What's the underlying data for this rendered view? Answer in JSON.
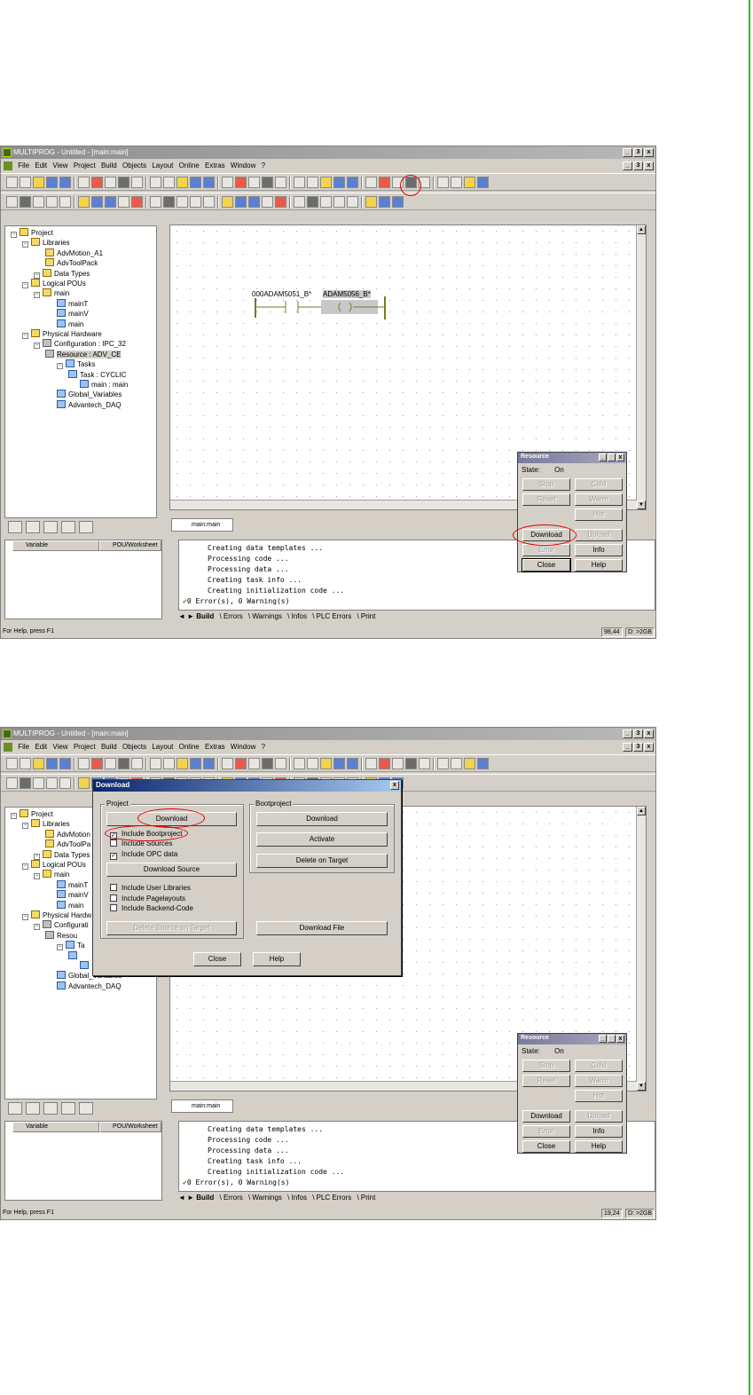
{
  "app": {
    "title_1": "MULTIPROG - Untitled - [main:main]",
    "title_2": "MULTIPROG - Untitled - [main:main]"
  },
  "menu": [
    "File",
    "Edit",
    "View",
    "Project",
    "Build",
    "Objects",
    "Layout",
    "Online",
    "Extras",
    "Window",
    "?"
  ],
  "window_buttons": {
    "minimize": "_",
    "restore": "3",
    "close": "x"
  },
  "tree": [
    {
      "label": "Project",
      "level": 0
    },
    {
      "label": "Libraries",
      "level": 1
    },
    {
      "label": "AdvMotion_A1",
      "level": 3
    },
    {
      "label": "AdvToolPack",
      "level": 3
    },
    {
      "label": "Data Types",
      "level": 2
    },
    {
      "label": "Logical POUs",
      "level": 1
    },
    {
      "label": "main",
      "level": 2
    },
    {
      "label": "mainT",
      "level": 4
    },
    {
      "label": "mainV",
      "level": 4
    },
    {
      "label": "main",
      "level": 4
    },
    {
      "label": "Physical Hardware",
      "level": 1
    },
    {
      "label": "Configuration : IPC_32",
      "level": 2
    },
    {
      "label": "Resource : ADV_CE",
      "level": 3
    },
    {
      "label": "Tasks",
      "level": 4
    },
    {
      "label": "Task : CYCLIC",
      "level": 5
    },
    {
      "label": "main : main",
      "level": 6
    },
    {
      "label": "Global_Variables",
      "level": 4
    },
    {
      "label": "Advantech_DAQ",
      "level": 4
    }
  ],
  "tree_2": [
    {
      "label": "Project",
      "level": 0
    },
    {
      "label": "Libraries",
      "level": 1
    },
    {
      "label": "AdvMotion",
      "level": 3
    },
    {
      "label": "AdvToolPa",
      "level": 3
    },
    {
      "label": "Data Types",
      "level": 2
    },
    {
      "label": "Logical POUs",
      "level": 1
    },
    {
      "label": "main",
      "level": 2
    },
    {
      "label": "mainT",
      "level": 4
    },
    {
      "label": "mainV",
      "level": 4
    },
    {
      "label": "main",
      "level": 4
    },
    {
      "label": "Physical Hardw",
      "level": 1
    },
    {
      "label": "Configurati",
      "level": 2
    },
    {
      "label": "Resou",
      "level": 3
    },
    {
      "label": "Ta",
      "level": 4
    },
    {
      "label": "",
      "level": 5
    },
    {
      "label": "",
      "level": 6
    },
    {
      "label": "Global_Variables",
      "level": 4
    },
    {
      "label": "Advantech_DAQ",
      "level": 4
    }
  ],
  "ladder": {
    "contact_label": "000ADAM5051_B*",
    "coil_label": "ADAM5056_B*"
  },
  "editor_tab": "main:main",
  "variables_panel": {
    "col_variable": "Variable",
    "col_pou": "POU/Worksheet"
  },
  "output": {
    "lines": [
      "Creating data templates ...",
      "Processing code ...",
      "Processing data ...",
      "Creating task info ...",
      "Creating initialization code ..."
    ],
    "result": "0 Error(s), 0 Warning(s)",
    "tabs": [
      "Build",
      "Errors",
      "Warnings",
      "Infos",
      "PLC Errors",
      "Print"
    ]
  },
  "status": {
    "help_text": "For Help, press F1",
    "coords_1": "98,44",
    "coords_2": "19,24",
    "disk": "D: >2GB"
  },
  "resource": {
    "title": "Resource",
    "state_label": "State:",
    "state_value": "On",
    "buttons": {
      "stop": "Stop",
      "cold": "Cold",
      "reset": "Reset",
      "warm": "Warm",
      "hot": "Hot",
      "download": "Download",
      "upload": "Upload",
      "error": "Error",
      "info": "Info",
      "close": "Close",
      "help": "Help"
    }
  },
  "download_dialog": {
    "title": "Download",
    "project_group": "Project",
    "bootproject_group": "Bootproject",
    "download_btn": "Download",
    "include_bootproject": "Include Bootproject",
    "include_sources": "Include Sources",
    "include_opc": "Include OPC data",
    "download_source_btn": "Download Source",
    "include_user_libs": "Include User Libraries",
    "include_pagelayouts": "Include Pagelayouts",
    "include_backend": "Include Backend-Code",
    "delete_source_btn": "Delete Source on Target",
    "boot_download_btn": "Download",
    "activate_btn": "Activate",
    "delete_on_target_btn": "Delete on Target",
    "download_file_btn": "Download File",
    "close_btn": "Close",
    "help_btn": "Help",
    "checked": {
      "include_bootproject": true,
      "include_sources": false,
      "include_opc": true,
      "include_user_libs": false,
      "include_pagelayouts": false,
      "include_backend": false
    }
  },
  "colors": {
    "annotation": "#e00000",
    "page_edge": "#19c319",
    "dialog_title": "#0a246a"
  }
}
